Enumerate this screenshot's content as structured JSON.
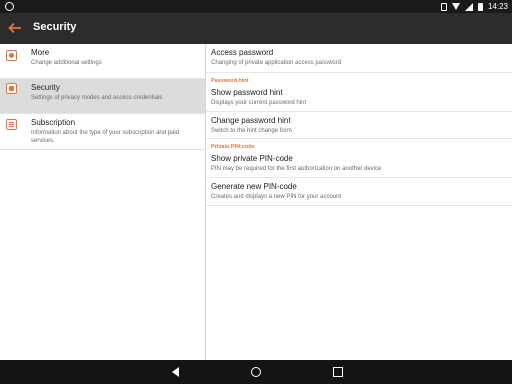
{
  "status_bar": {
    "time": "14:23"
  },
  "app_bar": {
    "title": "Security"
  },
  "colors": {
    "accent": "#e8743b",
    "app_bar": "#2c2c2c",
    "selected_bg": "#dcdcdc"
  },
  "left_menu": [
    {
      "title": "More",
      "subtitle": "Change additional settings",
      "icon": "gear-icon"
    },
    {
      "title": "Security",
      "subtitle": "Settings of privacy modes and access credentials",
      "icon": "lock-icon",
      "selected": true
    },
    {
      "title": "Subscription",
      "subtitle": "Information about the type of your subscription and paid services.",
      "icon": "list-icon"
    }
  ],
  "detail": {
    "access_password": {
      "title": "Access password",
      "subtitle": "Changing of private application access password"
    },
    "password_hint_header": "Password hint",
    "show_password_hint": {
      "title": "Show password hint",
      "subtitle": "Displays your current password hint"
    },
    "change_password_hint": {
      "title": "Change password hint",
      "subtitle": "Switch to the hint change form"
    },
    "pin_header": "Private PIN-code",
    "show_pin": {
      "title": "Show private PIN-code",
      "subtitle": "PIN may be required for the first authorization on another device"
    },
    "generate_pin": {
      "title": "Generate new PIN-code",
      "subtitle": "Creates and displays a new PIN for your account"
    }
  }
}
